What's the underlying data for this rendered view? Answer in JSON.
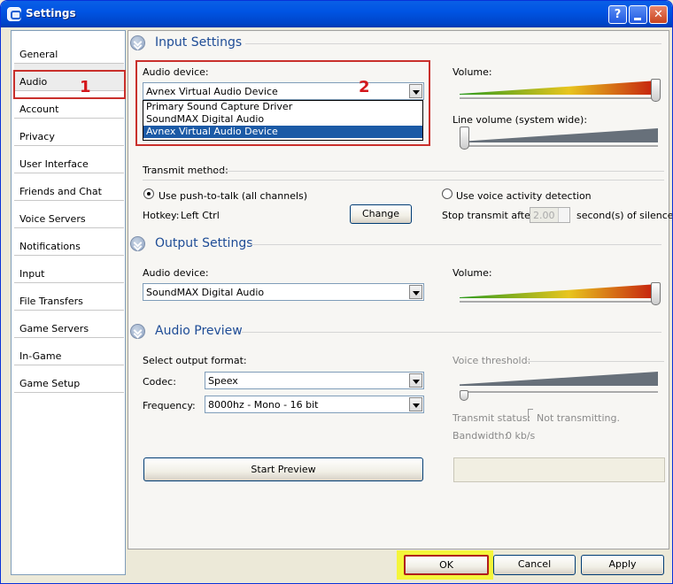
{
  "window": {
    "title": "Settings"
  },
  "nav": {
    "items": [
      "General",
      "Audio",
      "Account",
      "Privacy",
      "User Interface",
      "Friends and Chat",
      "Voice Servers",
      "Notifications",
      "Input",
      "File Transfers",
      "Game Servers",
      "In-Game",
      "Game Setup"
    ],
    "selected": "Audio"
  },
  "annotations": {
    "one": "1",
    "two": "2",
    "color": "#d4161b"
  },
  "input": {
    "title": "Input Settings",
    "device_label": "Audio device:",
    "device_value": "Avnex Virtual Audio Device",
    "device_options": [
      "Primary Sound Capture Driver",
      "SoundMAX Digital Audio",
      "Avnex Virtual Audio Device"
    ],
    "volume_label": "Volume:",
    "line_volume_label": "Line volume (system wide):",
    "volume_level": 1.0,
    "line_volume_level": 0.0,
    "transmit_label": "Transmit method:",
    "ptt_label": "Use push-to-talk (all channels)",
    "vad_label": "Use voice activity detection",
    "hotkey_label": "Hotkey:",
    "hotkey_value": "Left Ctrl",
    "change_label": "Change",
    "stop_label": "Stop transmit after:",
    "stop_value": "2.00",
    "stop_suffix": "second(s) of silence."
  },
  "output": {
    "title": "Output Settings",
    "device_label": "Audio device:",
    "device_value": "SoundMAX Digital Audio",
    "volume_label": "Volume:",
    "volume_level": 1.0
  },
  "preview": {
    "title": "Audio Preview",
    "format_label": "Select output format:",
    "codec_label": "Codec:",
    "codec_value": "Speex",
    "freq_label": "Frequency:",
    "freq_value": "8000hz - Mono - 16 bit",
    "threshold_label": "Voice threshold:",
    "threshold_level": 0.0,
    "status_label": "Transmit status:",
    "status_value": "Not transmitting.",
    "bandwidth_label": "Bandwidth:",
    "bandwidth_value": "0 kb/s",
    "start_label": "Start Preview"
  },
  "footer": {
    "ok": "OK",
    "cancel": "Cancel",
    "apply": "Apply"
  },
  "colors": {
    "accent": "#1e4c96",
    "selection": "#1b5aa6",
    "highlight": "#f4f53a"
  }
}
